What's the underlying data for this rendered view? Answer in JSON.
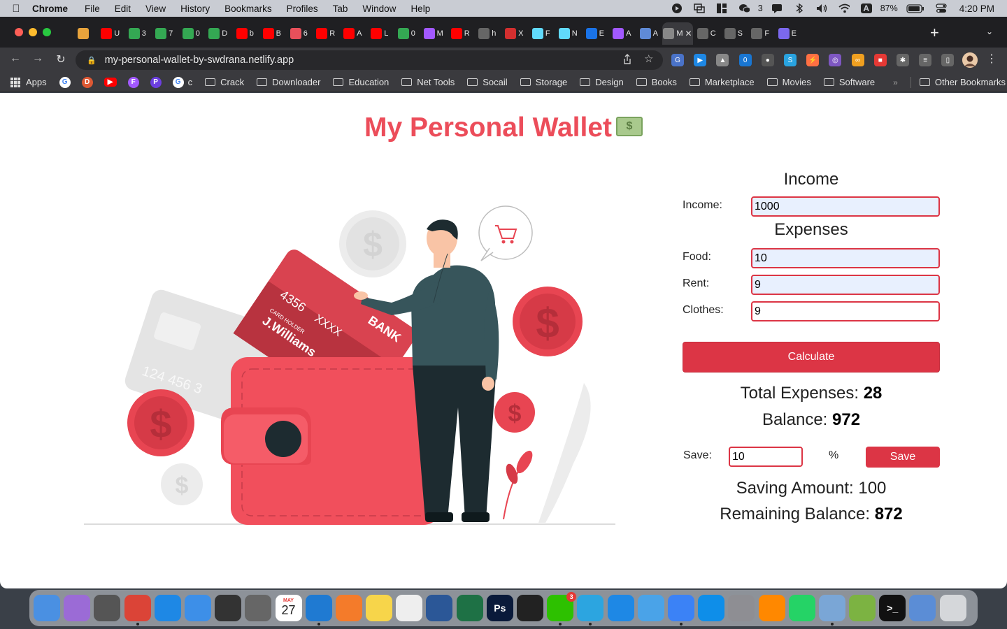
{
  "menubar": {
    "app": "Chrome",
    "items": [
      "File",
      "Edit",
      "View",
      "History",
      "Bookmarks",
      "Profiles",
      "Tab",
      "Window",
      "Help"
    ],
    "wechat_count": "3",
    "input_indicator": "A",
    "battery": "87%",
    "clock": "4:20 PM"
  },
  "tabs": [
    {
      "icon": "infinity-icon",
      "color": "#e8a33c",
      "label": ""
    },
    {
      "icon": "youtube-icon",
      "color": "#ff0000",
      "label": "U"
    },
    {
      "icon": "drive-icon",
      "color": "#34a853",
      "label": "3"
    },
    {
      "icon": "drive-icon",
      "color": "#34a853",
      "label": "7"
    },
    {
      "icon": "drive-icon",
      "color": "#34a853",
      "label": "0"
    },
    {
      "icon": "drive-icon",
      "color": "#34a853",
      "label": "D"
    },
    {
      "icon": "youtube-icon",
      "color": "#ff0000",
      "label": "b"
    },
    {
      "icon": "youtube-icon",
      "color": "#ff0000",
      "label": "B"
    },
    {
      "icon": "target-icon",
      "color": "#e8505b",
      "label": "6"
    },
    {
      "icon": "youtube-icon",
      "color": "#ff0000",
      "label": "R"
    },
    {
      "icon": "youtube-icon",
      "color": "#ff0000",
      "label": "A"
    },
    {
      "icon": "youtube-icon",
      "color": "#ff0000",
      "label": "L"
    },
    {
      "icon": "drive-icon",
      "color": "#34a853",
      "label": "0"
    },
    {
      "icon": "figma-icon",
      "color": "#a259ff",
      "label": "M"
    },
    {
      "icon": "youtube-icon",
      "color": "#ff0000",
      "label": "R"
    },
    {
      "icon": "globe-icon",
      "color": "#666",
      "label": "h"
    },
    {
      "icon": "pdf-icon",
      "color": "#d32f2f",
      "label": "X"
    },
    {
      "icon": "react-icon",
      "color": "#61dafb",
      "label": "F"
    },
    {
      "icon": "react-icon",
      "color": "#61dafb",
      "label": "N"
    },
    {
      "icon": "cursor-icon",
      "color": "#1a73e8",
      "label": "E"
    },
    {
      "icon": "figma-icon",
      "color": "#a259ff",
      "label": "A"
    },
    {
      "icon": "globe-icon",
      "color": "#5f8ad6",
      "label": "A"
    },
    {
      "icon": "page-icon",
      "color": "#888",
      "label": "M",
      "active": true
    },
    {
      "icon": "globe-icon",
      "color": "#666",
      "label": "C"
    },
    {
      "icon": "globe-icon",
      "color": "#666",
      "label": "S"
    },
    {
      "icon": "globe-icon",
      "color": "#666",
      "label": "F"
    },
    {
      "icon": "bulb-icon",
      "color": "#7b68ee",
      "label": "E"
    }
  ],
  "address": {
    "url": "my-personal-wallet-by-swdrana.netlify.app"
  },
  "extensions": [
    {
      "name": "translate-icon",
      "color": "#4a73c9",
      "label": "G"
    },
    {
      "name": "video-icon",
      "color": "#1e88e5",
      "label": "▶"
    },
    {
      "name": "mountain-icon",
      "color": "#888",
      "label": "▲"
    },
    {
      "name": "extension-badge-icon",
      "color": "#1976d2",
      "label": "0"
    },
    {
      "name": "user-icon",
      "color": "#555",
      "label": "●"
    },
    {
      "name": "screenshot-icon",
      "color": "#29a3e0",
      "label": "S"
    },
    {
      "name": "bolt-icon",
      "color": "#ff7043",
      "label": "⚡"
    },
    {
      "name": "ring-icon",
      "color": "#7e57c2",
      "label": "◎"
    },
    {
      "name": "glasses-icon",
      "color": "#f0a020",
      "label": "∞"
    },
    {
      "name": "palette-icon",
      "color": "#e53935",
      "label": "■"
    },
    {
      "name": "puzzle-icon",
      "color": "#666",
      "label": "✱"
    },
    {
      "name": "reading-list-icon",
      "color": "#666",
      "label": "≡"
    },
    {
      "name": "sidebar-icon",
      "color": "#666",
      "label": "▯"
    }
  ],
  "bookmarks": {
    "apps_label": "Apps",
    "c_label": "c",
    "folders": [
      "Crack",
      "Downloader",
      "Education",
      "Net Tools",
      "Socail",
      "Storage",
      "Design",
      "Books",
      "Marketplace",
      "Movies",
      "Software"
    ],
    "other": "Other Bookmarks"
  },
  "page": {
    "title": "My Personal Wallet",
    "income_heading": "Income",
    "expenses_heading": "Expenses",
    "income_label": "Income:",
    "income_value": "1000",
    "food_label": "Food:",
    "food_value": "10",
    "rent_label": "Rent:",
    "rent_value": "9",
    "clothes_label": "Clothes:",
    "clothes_value": "9",
    "calculate_label": "Calculate",
    "total_expenses_label": "Total Expenses:",
    "total_expenses_value": "28",
    "balance_label": "Balance:",
    "balance_value": "972",
    "save_label": "Save:",
    "save_value": "10",
    "percent_sign": "%",
    "save_button": "Save",
    "saving_amount_label": "Saving Amount:",
    "saving_amount_value": "100",
    "remaining_label": "Remaining Balance:",
    "remaining_value": "872",
    "illustration": {
      "card_bank": "BANK",
      "card_number": "4356",
      "card_holder_caption": "CARD HOLDER",
      "card_mask": "XXXX",
      "card_holder": "J.Williams",
      "back_card_number": "124 456 3",
      "coin_symbol": "$"
    },
    "colors": {
      "accent": "#dc3545",
      "title": "#ec4d5a"
    }
  },
  "dock": [
    {
      "name": "finder-icon",
      "color": "#4a90e2"
    },
    {
      "name": "feather-icon",
      "color": "#9b6bd6"
    },
    {
      "name": "calculator-icon",
      "color": "#555"
    },
    {
      "name": "chrome-icon",
      "color": "#db4437",
      "running": true
    },
    {
      "name": "safari-icon",
      "color": "#1e88e5"
    },
    {
      "name": "mail-icon",
      "color": "#3d8fe8"
    },
    {
      "name": "photos-grid-icon",
      "color": "#333"
    },
    {
      "name": "screenshot-icon",
      "color": "#666"
    },
    {
      "name": "calendar-icon",
      "color": "#fff",
      "label": "27",
      "month": "MAY"
    },
    {
      "name": "vscode-icon",
      "color": "#1f7ad2",
      "running": true
    },
    {
      "name": "pen-icon",
      "color": "#f47b2a"
    },
    {
      "name": "notes-icon",
      "color": "#f7d54a"
    },
    {
      "name": "textedit-icon",
      "color": "#eee"
    },
    {
      "name": "word-icon",
      "color": "#2b5797"
    },
    {
      "name": "excel-icon",
      "color": "#1e7145"
    },
    {
      "name": "photoshop-icon",
      "color": "#0a1a3a",
      "label": "Ps"
    },
    {
      "name": "activity-monitor-icon",
      "color": "#222"
    },
    {
      "name": "wechat-icon",
      "color": "#2dc100",
      "badge": "3",
      "running": true
    },
    {
      "name": "telegram-icon",
      "color": "#2ca5e0",
      "running": true
    },
    {
      "name": "mountain-app-icon",
      "color": "#1e88e5"
    },
    {
      "name": "cube-app-icon",
      "color": "#4aa3e8"
    },
    {
      "name": "screen-share-icon",
      "color": "#3b82f6",
      "running": true
    },
    {
      "name": "teamviewer-icon",
      "color": "#0e8ee9"
    },
    {
      "name": "settings-icon",
      "color": "#8e8e93"
    },
    {
      "name": "vlc-icon",
      "color": "#ff8800"
    },
    {
      "name": "whatsapp-icon",
      "color": "#25d366"
    },
    {
      "name": "preview-icon",
      "color": "#7aa6d6",
      "running": true
    },
    {
      "name": "snail-icon",
      "color": "#7cb342"
    },
    {
      "name": "terminal-icon",
      "color": "#111",
      "label": ">_"
    },
    {
      "name": "virtualbox-icon",
      "color": "#5b8dd6"
    },
    {
      "name": "trash-icon",
      "color": "#d5d7da"
    }
  ]
}
